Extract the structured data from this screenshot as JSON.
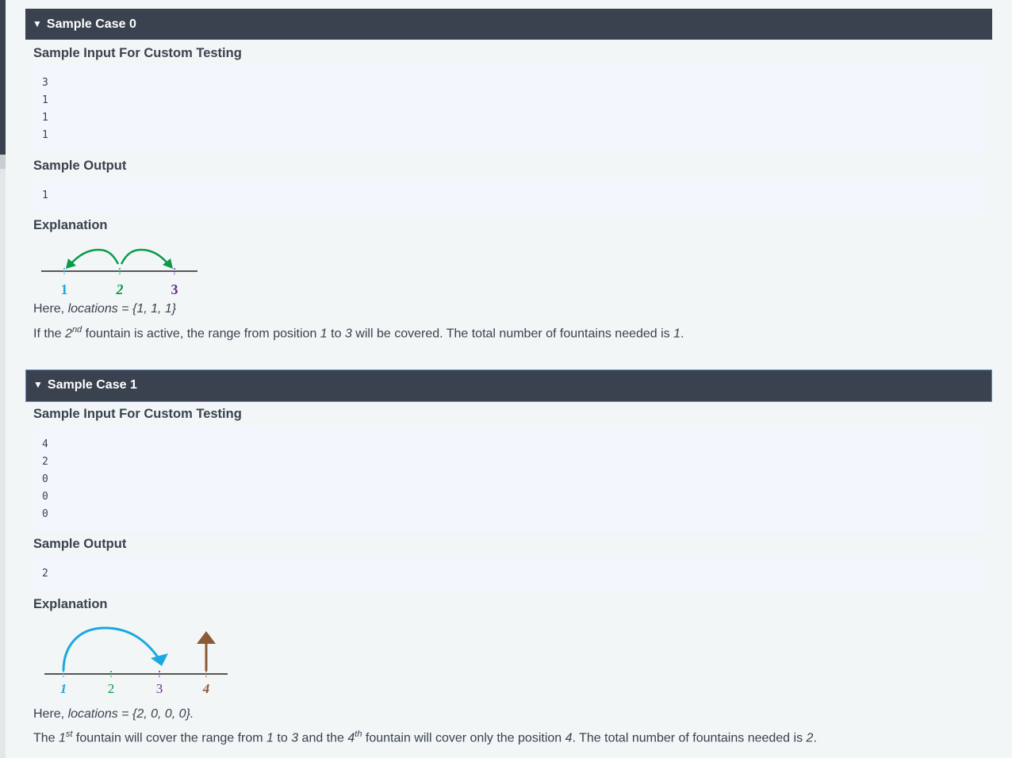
{
  "cases": [
    {
      "header": "Sample Case 0",
      "input_title": "Sample Input For Custom Testing",
      "input_lines": [
        "3",
        "1",
        "1",
        "1"
      ],
      "output_title": "Sample Output",
      "output_lines": [
        "1"
      ],
      "explanation_title": "Explanation",
      "diagram_labels": [
        "1",
        "2",
        "3"
      ],
      "here_prefix": "Here, ",
      "here_var": "locations",
      "here_value": " = {1, 1, 1}",
      "desc": {
        "p1": "If the ",
        "ord": "2",
        "ord_sup": "nd",
        "p2": " fountain is active, the range from position ",
        "v1": "1",
        "p3": " to ",
        "v2": "3",
        "p4": " will be covered. The total number of fountains needed is ",
        "v3": "1",
        "p5": "."
      }
    },
    {
      "header": "Sample Case 1",
      "input_title": "Sample Input For Custom Testing",
      "input_lines": [
        "4",
        "2",
        "0",
        "0",
        "0"
      ],
      "output_title": "Sample Output",
      "output_lines": [
        "2"
      ],
      "explanation_title": "Explanation",
      "diagram_labels": [
        "1",
        "2",
        "3",
        "4"
      ],
      "here_prefix": "Here, ",
      "here_var": "locations",
      "here_value": " = {2, 0, 0, 0}.",
      "desc": {
        "p1": "The ",
        "ord": "1",
        "ord_sup": "st",
        "p2": " fountain will cover the range from ",
        "v1": "1",
        "p3": " to ",
        "v2": "3",
        "p4": " and the ",
        "ord2": "4",
        "ord2_sup": "th",
        "p5": " fountain will cover only the position ",
        "v3": "4",
        "p6": ". The total number of fountains needed is ",
        "v4": "2",
        "p7": "."
      }
    }
  ],
  "colors": {
    "header_bg": "#39424e",
    "code_bg": "#f3f7fd",
    "green": "#0a9a4a",
    "blue": "#1ba8e0",
    "purple": "#6a2c8c",
    "brown": "#8a5a36"
  }
}
